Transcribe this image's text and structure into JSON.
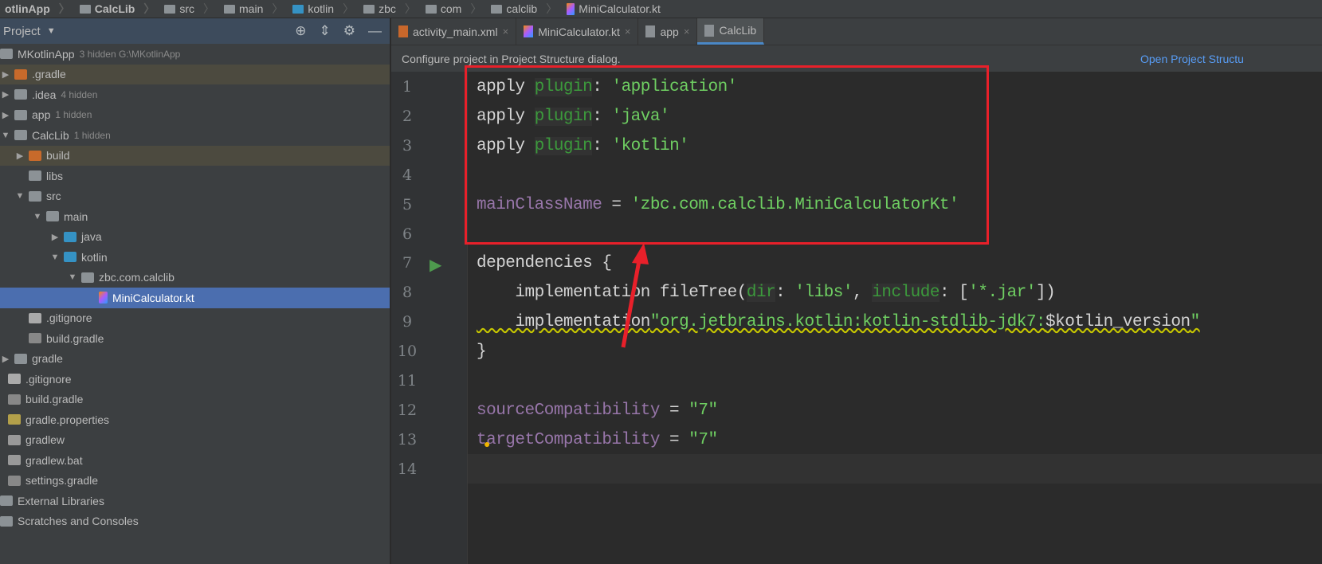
{
  "breadcrumb": [
    "otlinApp",
    "CalcLib",
    "src",
    "main",
    "kotlin",
    "zbc",
    "com",
    "calclib",
    "MiniCalculator.kt"
  ],
  "sidebar": {
    "title": "Project",
    "items": [
      {
        "label": "MKotlinApp",
        "hint": "3 hidden  G:\\MKotlinApp",
        "level": 0,
        "arrow": "",
        "icon": "module"
      },
      {
        "label": ".gradle",
        "level": 0,
        "arrow": "▶",
        "icon": "orange",
        "hl": true
      },
      {
        "label": ".idea",
        "hint": "4 hidden",
        "level": 0,
        "arrow": "▶",
        "icon": "folder"
      },
      {
        "label": "app",
        "hint": "1 hidden",
        "level": 0,
        "arrow": "▶",
        "icon": "folder"
      },
      {
        "label": "CalcLib",
        "hint": "1 hidden",
        "level": 0,
        "arrow": "▼",
        "icon": "folder"
      },
      {
        "label": "build",
        "level": 1,
        "arrow": "▶",
        "icon": "orange",
        "hl": true
      },
      {
        "label": "libs",
        "level": 1,
        "arrow": "",
        "icon": "folder"
      },
      {
        "label": "src",
        "level": 1,
        "arrow": "▼",
        "icon": "folder"
      },
      {
        "label": "main",
        "level": 2,
        "arrow": "▼",
        "icon": "folder"
      },
      {
        "label": "java",
        "level": 3,
        "arrow": "▶",
        "icon": "blue"
      },
      {
        "label": "kotlin",
        "level": 3,
        "arrow": "▼",
        "icon": "blue"
      },
      {
        "label": "zbc.com.calclib",
        "level": 4,
        "arrow": "▼",
        "icon": "folder"
      },
      {
        "label": "MiniCalculator.kt",
        "level": 5,
        "arrow": "",
        "icon": "kt",
        "sel": true
      },
      {
        "label": ".gitignore",
        "level": 1,
        "arrow": "",
        "icon": "git"
      },
      {
        "label": "build.gradle",
        "level": 1,
        "arrow": "",
        "icon": "gradle"
      },
      {
        "label": "gradle",
        "level": 0,
        "arrow": "▶",
        "icon": "folder"
      },
      {
        "label": ".gitignore",
        "level": 0,
        "arrow": "",
        "icon": "git"
      },
      {
        "label": "build.gradle",
        "level": 0,
        "arrow": "",
        "icon": "gradle"
      },
      {
        "label": "gradle.properties",
        "level": 0,
        "arrow": "",
        "icon": "props"
      },
      {
        "label": "gradlew",
        "level": 0,
        "arrow": "",
        "icon": "file"
      },
      {
        "label": "gradlew.bat",
        "level": 0,
        "arrow": "",
        "icon": "file"
      },
      {
        "label": "settings.gradle",
        "level": 0,
        "arrow": "",
        "icon": "gradle"
      },
      {
        "label": "External Libraries",
        "level": -1,
        "arrow": "",
        "icon": "lib"
      },
      {
        "label": "Scratches and Consoles",
        "level": -1,
        "arrow": "",
        "icon": "scratch"
      }
    ]
  },
  "tabs": [
    {
      "label": "activity_main.xml",
      "close": "×"
    },
    {
      "label": "MiniCalculator.kt",
      "close": "×"
    },
    {
      "label": "app",
      "close": "×"
    },
    {
      "label": "CalcLib",
      "active": true
    }
  ],
  "notice": {
    "text": "Configure project in Project Structure dialog.",
    "link": "Open Project Structu"
  },
  "code": {
    "l1": [
      "apply ",
      "plugin",
      ": ",
      "'application'"
    ],
    "l2": [
      "apply ",
      "plugin",
      ": ",
      "'java'"
    ],
    "l3": [
      "apply ",
      "plugin",
      ": ",
      "'kotlin'"
    ],
    "l5": [
      "mainClassName",
      " = ",
      "'zbc.com.calclib.MiniCalculatorKt'"
    ],
    "l7": "dependencies {",
    "l8": [
      "    implementation fileTree(",
      "dir",
      ": ",
      "'libs'",
      ", ",
      "include",
      ": [",
      "'*.jar'",
      "])"
    ],
    "l9": [
      "    implementation",
      "\"org.jetbrains.kotlin:kotlin-stdlib-jdk7:",
      "$kotlin_version",
      "\""
    ],
    "l10": "}",
    "l12": [
      "sourceCompatibility",
      " = ",
      "\"7\""
    ],
    "l13": [
      "targetCompatibility",
      " = ",
      "\"7\""
    ]
  },
  "line_numbers": [
    "1",
    "2",
    "3",
    "4",
    "5",
    "6",
    "7",
    "8",
    "9",
    "10",
    "11",
    "12",
    "13",
    "14"
  ]
}
